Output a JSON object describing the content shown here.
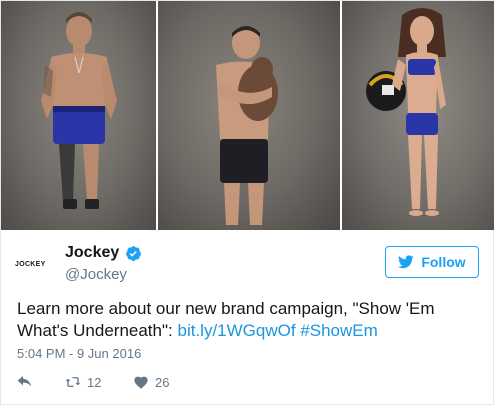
{
  "profile": {
    "name": "Jockey",
    "handle": "@Jockey",
    "logo_text": "JOCKEY",
    "verified": true
  },
  "follow_button": {
    "label": "Follow",
    "icon": "bird-icon"
  },
  "tweet": {
    "text_before": "Learn more about our new brand campaign, \"Show 'Em What's Underneath\": ",
    "link": "bit.ly/1WGqwOf",
    "separator": " ",
    "hashtag": "#ShowEm",
    "timestamp": "5:04 PM - 9 Jun 2016"
  },
  "actions": {
    "reply_icon": "reply-icon",
    "retweet_icon": "retweet-icon",
    "retweet_count": "12",
    "like_icon": "heart-icon",
    "like_count": "26"
  },
  "photos": [
    {
      "subject": "man-with-prosthetic-leg"
    },
    {
      "subject": "man-holding-baby"
    },
    {
      "subject": "woman-holding-helmet"
    }
  ],
  "colors": {
    "accent": "#1da1f2",
    "link": "#1b95e0",
    "muted": "#657786",
    "underwear": "#2a36a8"
  }
}
